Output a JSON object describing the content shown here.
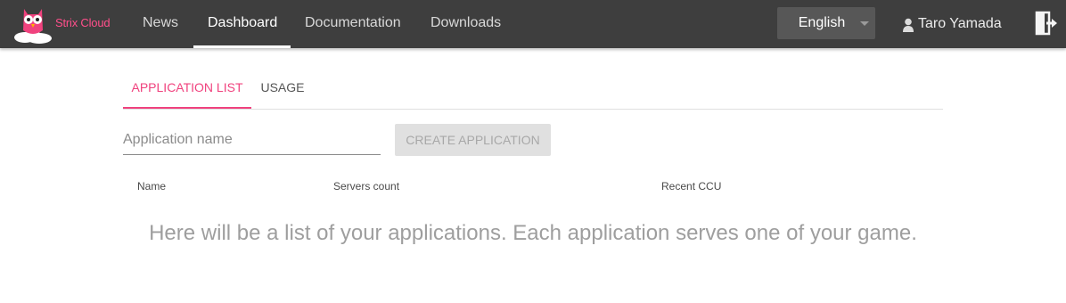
{
  "header": {
    "brand": "Strix Cloud",
    "nav": [
      {
        "label": "News"
      },
      {
        "label": "Dashboard",
        "active": true
      },
      {
        "label": "Documentation"
      },
      {
        "label": "Downloads"
      }
    ],
    "language": "English",
    "user_name": "Taro Yamada",
    "icons": {
      "logo": "owl-logo-icon",
      "user": "user-icon",
      "logout": "logout-icon",
      "caret": "caret-down-icon"
    }
  },
  "tabs": [
    {
      "label": "APPLICATION LIST",
      "active": true
    },
    {
      "label": "USAGE"
    }
  ],
  "form": {
    "app_name_placeholder": "Application name",
    "create_label": "CREATE APPLICATION"
  },
  "table": {
    "columns": [
      "Name",
      "Servers count",
      "Recent CCU"
    ],
    "empty_message": "Here will be a list of your applications. Each application serves one of your game."
  },
  "colors": {
    "accent": "#f0427e",
    "header_bg": "#3e3e3e",
    "brand": "#ff4f8b"
  }
}
